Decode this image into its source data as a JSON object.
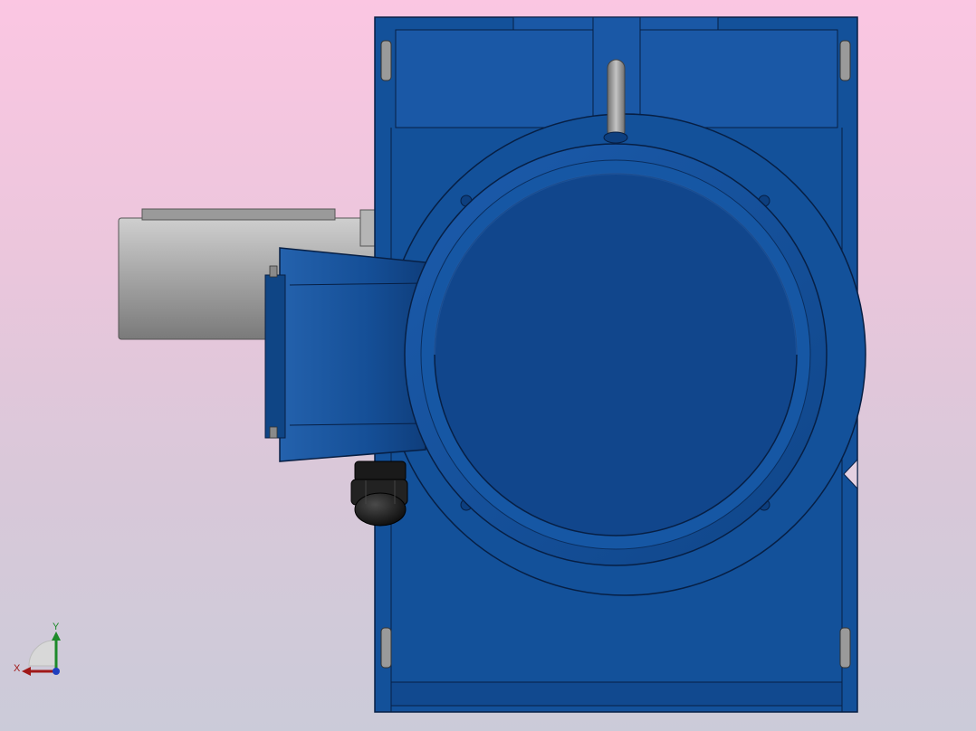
{
  "viewport": {
    "background_top": "#fbc6e2",
    "background_bottom": "#cbcbd9"
  },
  "model": {
    "body_color": "#13519a",
    "body_dark": "#0d3f7f",
    "motor_color": "#9c9c9c",
    "cable_gland_color": "#1a1a1a",
    "eyebolt_color": "#8a8a8a"
  },
  "triad": {
    "x_label": "X",
    "y_label": "Y",
    "x_color": "#a01818",
    "y_color": "#1d8a2a",
    "z_color": "#1f3fbf"
  }
}
